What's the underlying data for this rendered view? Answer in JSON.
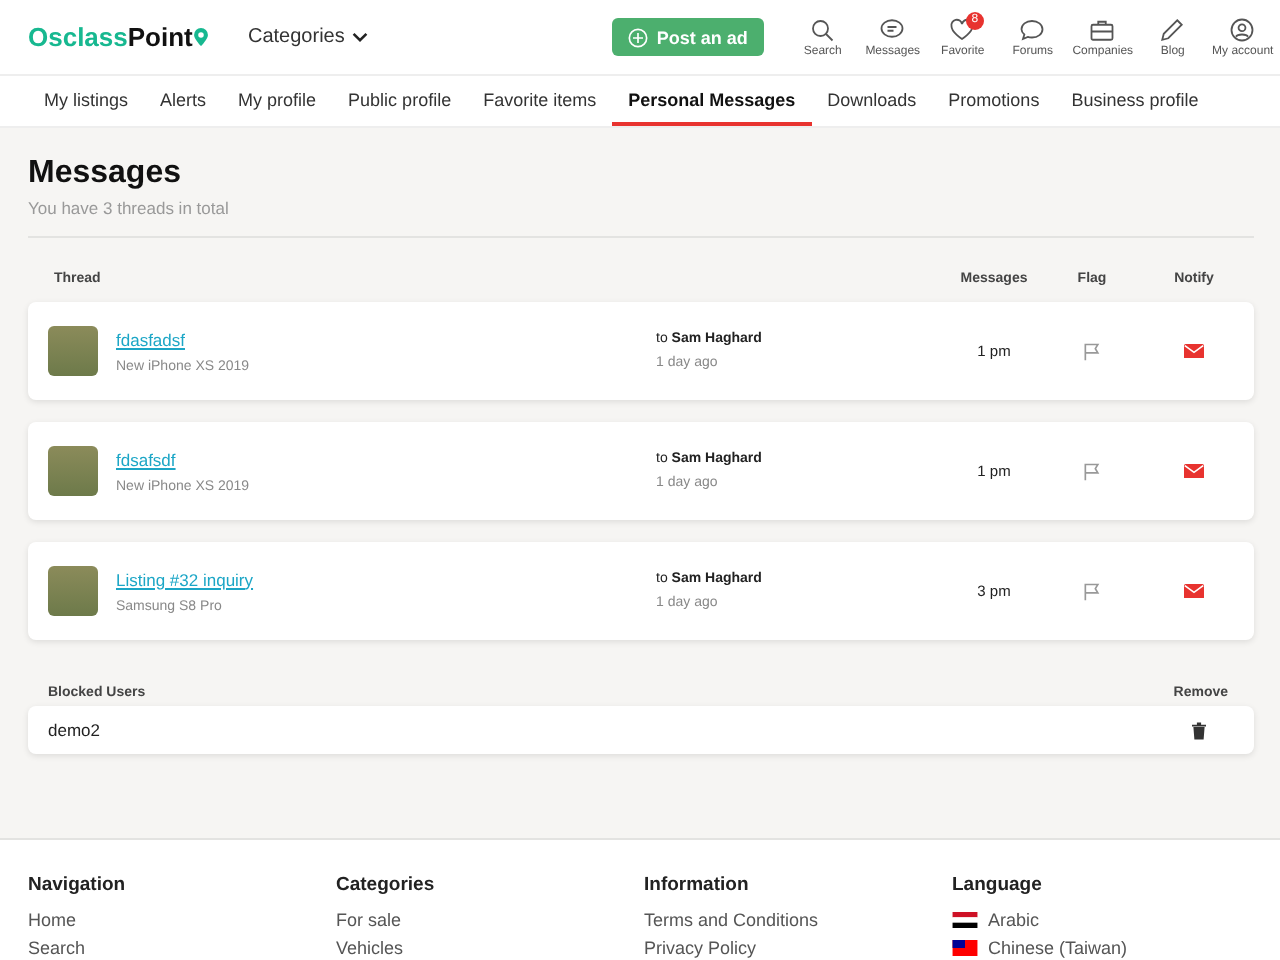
{
  "header": {
    "logo": {
      "part1": "Osclass",
      "part2": "Point"
    },
    "categories": "Categories",
    "post_button": "Post an ad",
    "icons": [
      {
        "label": "Search"
      },
      {
        "label": "Messages"
      },
      {
        "label": "Favorite",
        "badge": "8"
      },
      {
        "label": "Forums"
      },
      {
        "label": "Companies"
      },
      {
        "label": "Blog"
      },
      {
        "label": "My account"
      }
    ]
  },
  "tabs": [
    {
      "label": "My listings",
      "selected": false
    },
    {
      "label": "Alerts",
      "selected": false
    },
    {
      "label": "My profile",
      "selected": false
    },
    {
      "label": "Public profile",
      "selected": false
    },
    {
      "label": "Favorite items",
      "selected": false
    },
    {
      "label": "Personal Messages",
      "selected": true
    },
    {
      "label": "Downloads",
      "selected": false
    },
    {
      "label": "Promotions",
      "selected": false
    },
    {
      "label": "Business profile",
      "selected": false
    }
  ],
  "page": {
    "title": "Messages",
    "subtitle": "You have 3 threads in total"
  },
  "threads": {
    "columns": [
      "Thread",
      "Messages",
      "Flag",
      "Notify"
    ],
    "rows": [
      {
        "title": "fdasfadsf",
        "item": "New iPhone XS 2019",
        "to_prefix": "to",
        "to": "Sam Haghard",
        "ago": "1 day ago",
        "messages": "1 pm"
      },
      {
        "title": "fdsafsdf",
        "item": "New iPhone XS 2019",
        "to_prefix": "to",
        "to": "Sam Haghard",
        "ago": "1 day ago",
        "messages": "1 pm"
      },
      {
        "title": "Listing #32 inquiry",
        "item": "Samsung S8 Pro",
        "to_prefix": "to",
        "to": "Sam Haghard",
        "ago": "1 day ago",
        "messages": "3 pm"
      }
    ]
  },
  "blocked": {
    "columns": [
      "Blocked Users",
      "Remove"
    ],
    "rows": [
      {
        "name": "demo2"
      }
    ]
  },
  "footer": [
    {
      "heading": "Navigation",
      "links": [
        {
          "label": "Home"
        },
        {
          "label": "Search"
        }
      ]
    },
    {
      "heading": "Categories",
      "links": [
        {
          "label": "For sale"
        },
        {
          "label": "Vehicles"
        }
      ]
    },
    {
      "heading": "Information",
      "links": [
        {
          "label": "Terms and Conditions"
        },
        {
          "label": "Privacy Policy"
        }
      ]
    },
    {
      "heading": "Language",
      "links": [
        {
          "label": "Arabic"
        },
        {
          "label": "Chinese (Taiwan)"
        }
      ]
    }
  ]
}
